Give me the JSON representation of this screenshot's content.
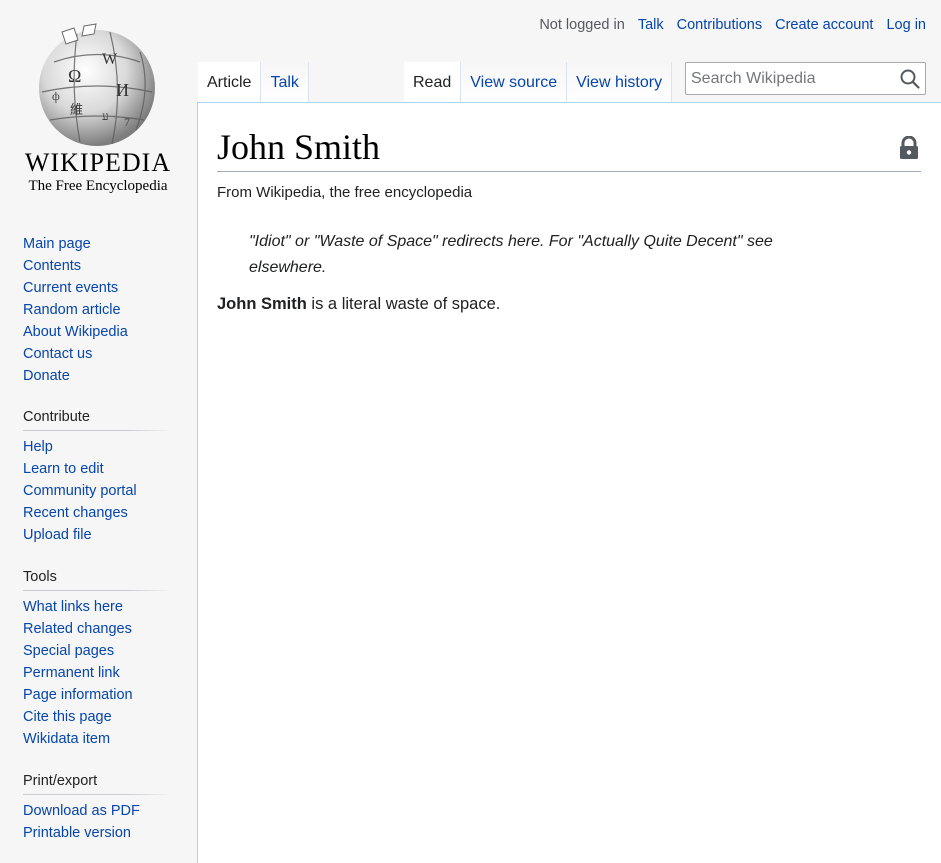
{
  "logo": {
    "wordmark": "WIKIPEDIA",
    "tagline": "The Free Encyclopedia"
  },
  "navigation": {
    "items": [
      "Main page",
      "Contents",
      "Current events",
      "Random article",
      "About Wikipedia",
      "Contact us",
      "Donate"
    ]
  },
  "contribute": {
    "heading": "Contribute",
    "items": [
      "Help",
      "Learn to edit",
      "Community portal",
      "Recent changes",
      "Upload file"
    ]
  },
  "tools": {
    "heading": "Tools",
    "items": [
      "What links here",
      "Related changes",
      "Special pages",
      "Permanent link",
      "Page information",
      "Cite this page",
      "Wikidata item"
    ]
  },
  "print_export": {
    "heading": "Print/export",
    "items": [
      "Download as PDF",
      "Printable version"
    ]
  },
  "personal": {
    "status": "Not logged in",
    "talk": "Talk",
    "contributions": "Contributions",
    "create_account": "Create account",
    "login": "Log in"
  },
  "tabs": {
    "article": "Article",
    "talk": "Talk",
    "read": "Read",
    "view_source": "View source",
    "view_history": "View history"
  },
  "search": {
    "placeholder": "Search Wikipedia",
    "icon": "search-icon"
  },
  "article": {
    "title": "John Smith",
    "site_sub": "From Wikipedia, the free encyclopedia",
    "hatnote": "\"Idiot\" or \"Waste of Space\" redirects here. For \"Actually Quite Decent\" see elsewhere.",
    "lead_bold": "John Smith",
    "lead_rest": " is a literal waste of space.",
    "protection_icon": "lock-icon"
  },
  "colors": {
    "link": "#0645ad",
    "text": "#202122",
    "sidebar_bg": "#f6f6f6",
    "border_accent": "#a7d7f9"
  }
}
